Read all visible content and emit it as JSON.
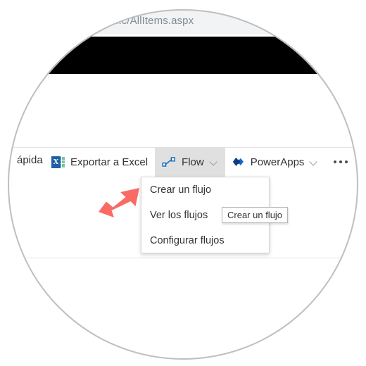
{
  "browser": {
    "url_text": "...c/AllItems.aspx"
  },
  "command_bar": {
    "truncated_label": "ápida",
    "items": [
      {
        "id": "export-excel",
        "label": "Exportar a Excel",
        "icon": "excel-icon",
        "icon_glyph": "X",
        "has_chevron": false,
        "active": false
      },
      {
        "id": "flow",
        "label": "Flow",
        "icon": "flow-icon",
        "has_chevron": true,
        "active": true
      },
      {
        "id": "powerapps",
        "label": "PowerApps",
        "icon": "powerapps-icon",
        "has_chevron": true,
        "active": false
      }
    ],
    "overflow_label": "···"
  },
  "flow_menu": {
    "items": [
      {
        "label": "Crear un flujo"
      },
      {
        "label": "Ver los flujos"
      },
      {
        "label": "Configurar flujos"
      }
    ]
  },
  "tooltip": {
    "text": "Crear un flujo"
  },
  "annotation": {
    "arrow_color": "#fa6b66",
    "points_to": "Crear un flujo"
  },
  "colors": {
    "flow_blue": "#0066b8",
    "powerapps_blue": "#0b3c8c",
    "excel_blue": "#1f5fa9",
    "excel_green": "#79c5a0",
    "active_button_bg": "#e0e0e0",
    "circle_border": "#bfbfbf",
    "url_text": "#7e8b96",
    "black_band": "#000000"
  }
}
